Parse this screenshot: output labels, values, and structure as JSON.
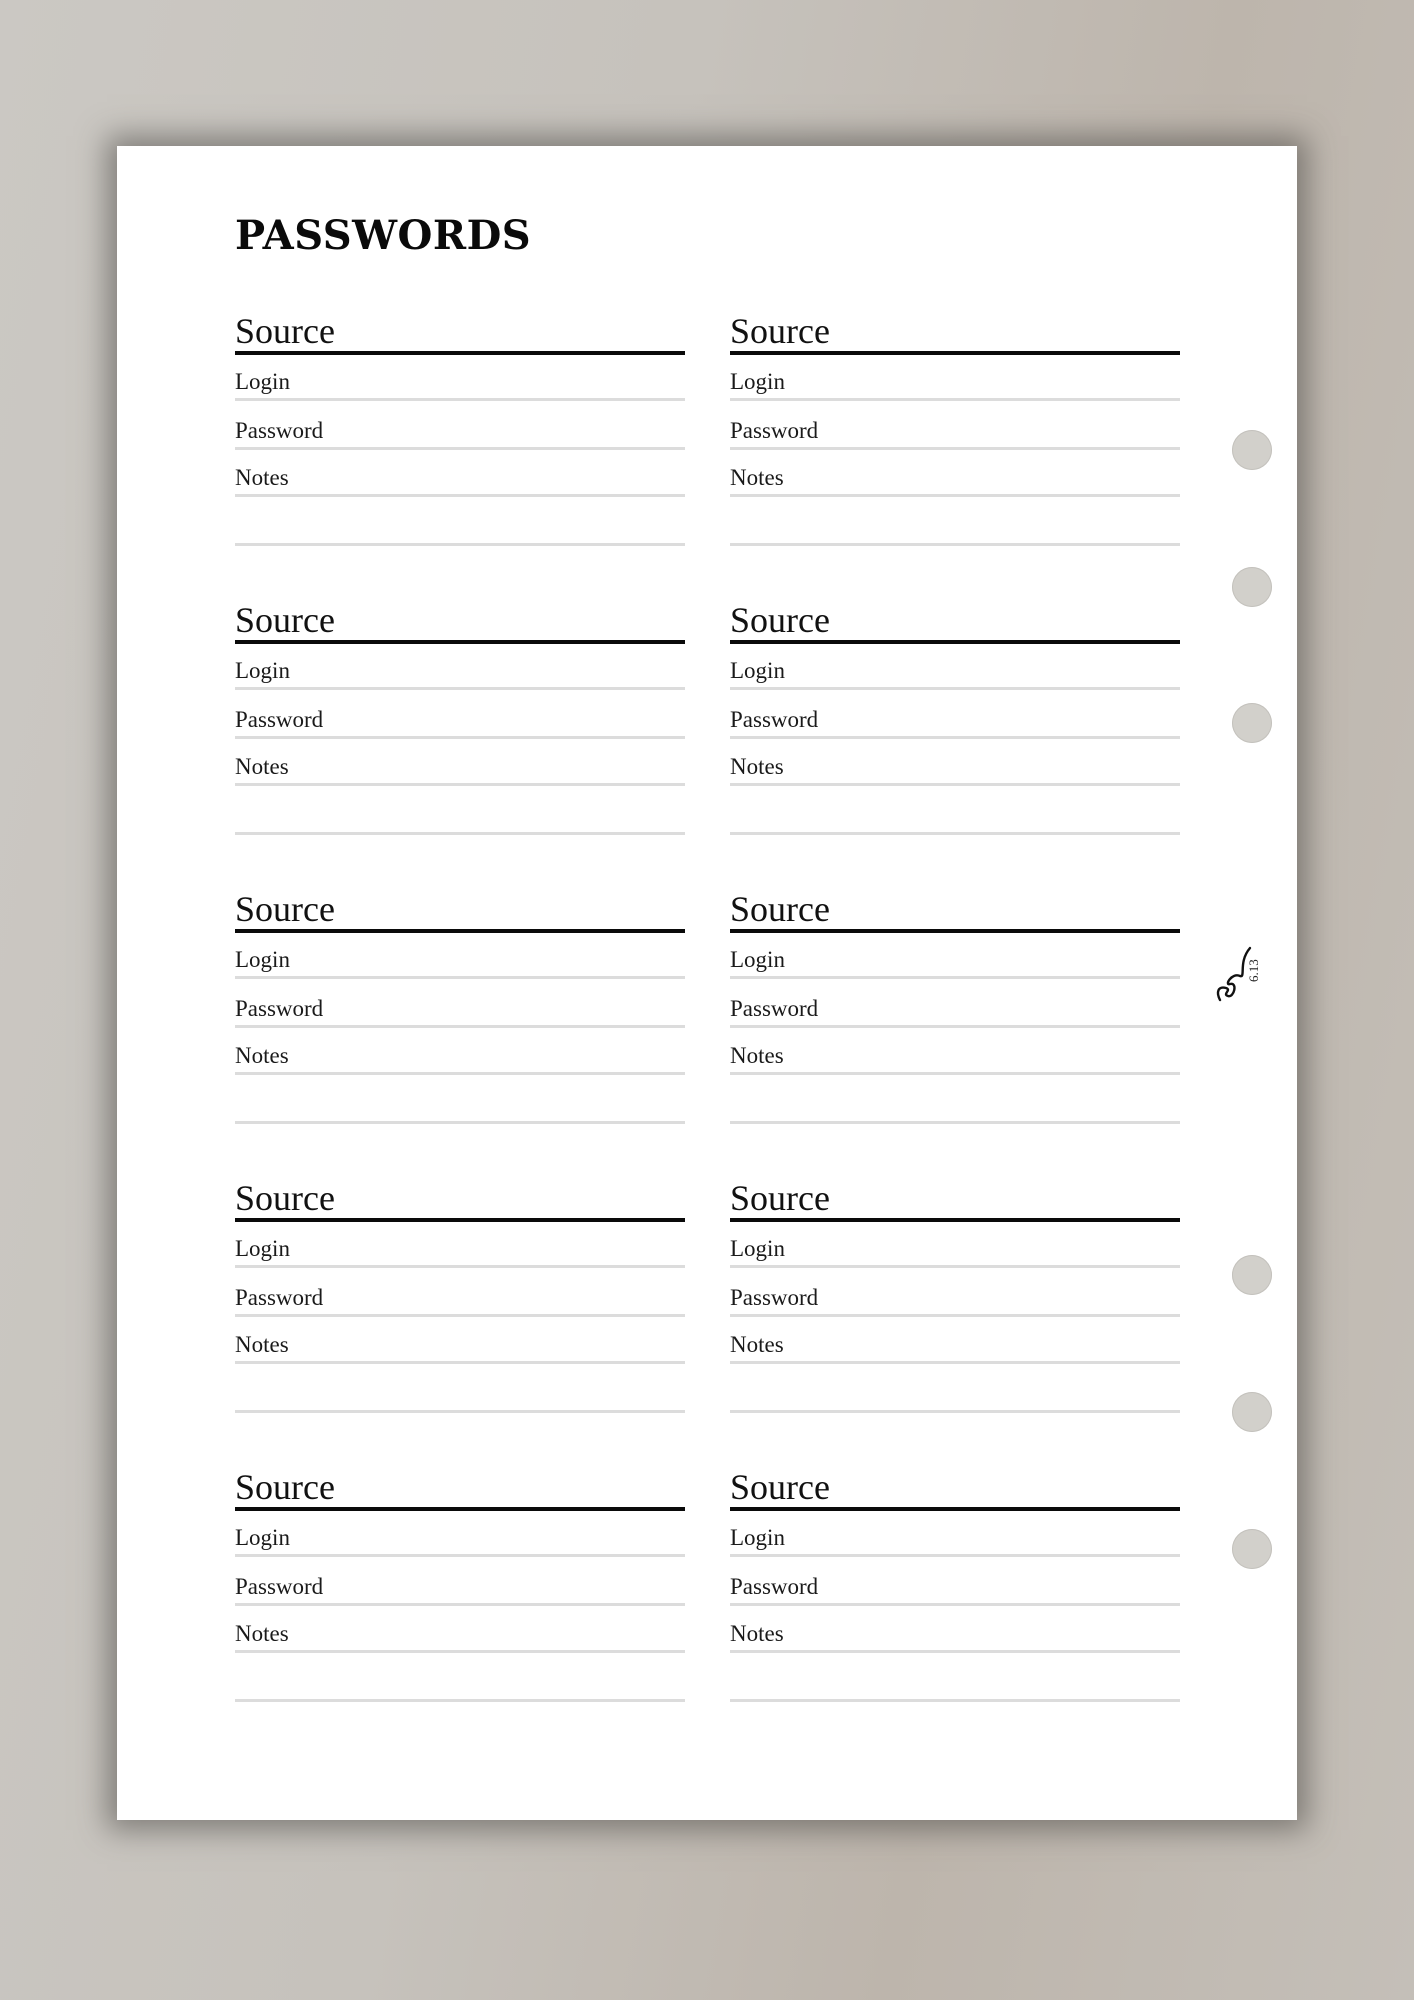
{
  "page": {
    "title": "PASSWORDS",
    "entries": [
      {
        "source": "Source",
        "fields": [
          "Login",
          "Password",
          "Notes",
          ""
        ]
      },
      {
        "source": "Source",
        "fields": [
          "Login",
          "Password",
          "Notes",
          ""
        ]
      },
      {
        "source": "Source",
        "fields": [
          "Login",
          "Password",
          "Notes",
          ""
        ]
      },
      {
        "source": "Source",
        "fields": [
          "Login",
          "Password",
          "Notes",
          ""
        ]
      },
      {
        "source": "Source",
        "fields": [
          "Login",
          "Password",
          "Notes",
          ""
        ]
      },
      {
        "source": "Source",
        "fields": [
          "Login",
          "Password",
          "Notes",
          ""
        ]
      },
      {
        "source": "Source",
        "fields": [
          "Login",
          "Password",
          "Notes",
          ""
        ]
      },
      {
        "source": "Source",
        "fields": [
          "Login",
          "Password",
          "Notes",
          ""
        ]
      },
      {
        "source": "Source",
        "fields": [
          "Login",
          "Password",
          "Notes",
          ""
        ]
      },
      {
        "source": "Source",
        "fields": [
          "Login",
          "Password",
          "Notes",
          ""
        ]
      }
    ],
    "signature": {
      "icon": "signature-m-icon",
      "number": "6.13"
    },
    "holes": {
      "icon": "binder-hole-icon",
      "count": 6
    }
  },
  "colors": {
    "background": "#c8c4be",
    "paper": "#ffffff",
    "rule": "#0a0a0a",
    "field_line": "#dcdcdc",
    "hole": "#d2d0cb"
  }
}
